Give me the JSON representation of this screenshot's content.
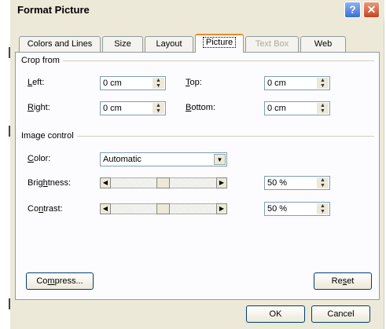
{
  "dialog": {
    "title": "Format Picture"
  },
  "titlebar": {
    "help": "?",
    "close": "✕"
  },
  "tabs": [
    {
      "label": "Colors and Lines"
    },
    {
      "label": "Size"
    },
    {
      "label": "Layout"
    },
    {
      "label": "Picture",
      "active": true
    },
    {
      "label": "Text Box",
      "disabled": true
    },
    {
      "label": "Web"
    }
  ],
  "crop": {
    "title": "Crop from",
    "left": {
      "mnemonic": "L",
      "rest": "eft:",
      "value": "0 cm"
    },
    "right": {
      "mnemonic": "R",
      "rest": "ight:",
      "value": "0 cm"
    },
    "top": {
      "mnemonic": "T",
      "rest": "op:",
      "value": "0 cm"
    },
    "bottom": {
      "mnemonic": "B",
      "rest": "ottom:",
      "value": "0 cm"
    }
  },
  "image_control": {
    "title": "Image control",
    "color": {
      "mnemonic": "C",
      "rest": "olor:",
      "value": "Automatic"
    },
    "brightness": {
      "pre": "Brig",
      "mnemonic": "h",
      "rest": "tness:",
      "value": "50 %",
      "level": 0.5
    },
    "contrast": {
      "pre": "Co",
      "mnemonic": "n",
      "rest": "trast:",
      "value": "50 %",
      "level": 0.5
    }
  },
  "buttons": {
    "compress": {
      "pre": "Co",
      "mnemonic": "m",
      "rest": "press..."
    },
    "reset": {
      "pre": "Re",
      "mnemonic": "s",
      "rest": "et"
    },
    "ok": "OK",
    "cancel": "Cancel"
  },
  "icons": [
    "help-icon",
    "close-icon",
    "spin-up-icon",
    "spin-down-icon",
    "dropdown-arrow-icon",
    "scroll-left-icon",
    "scroll-right-icon"
  ]
}
